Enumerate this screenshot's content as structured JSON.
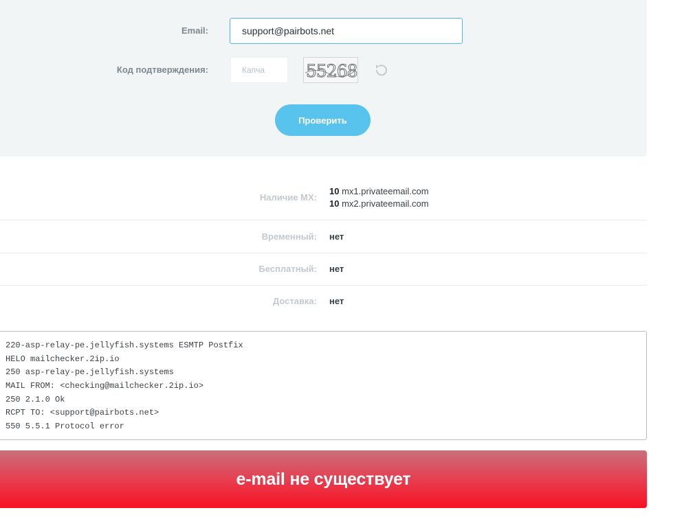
{
  "form": {
    "email_label": "Email:",
    "email_value": "support@pairbots.net",
    "captcha_label": "Код подтверждения:",
    "captcha_placeholder": "Капча",
    "captcha_text": "55268",
    "refresh_icon": "refresh-icon",
    "check_button": "Проверить"
  },
  "results": {
    "mx_label": "Наличие MX:",
    "mx_records": [
      {
        "priority": "10",
        "host": "mx1.privateemail.com"
      },
      {
        "priority": "10",
        "host": "mx2.privateemail.com"
      }
    ],
    "temporary_label": "Временный:",
    "temporary_value": "нет",
    "free_label": "Бесплатный:",
    "free_value": "нет",
    "delivery_label": "Доставка:",
    "delivery_value": "нет"
  },
  "log": [
    "220-asp-relay-pe.jellyfish.systems ESMTP Postfix",
    "HELO mailchecker.2ip.io",
    "250 asp-relay-pe.jellyfish.systems",
    "MAIL FROM: <checking@mailchecker.2ip.io>",
    "250 2.1.0 Ok",
    "RCPT TO: <support@pairbots.net>",
    "550 5.5.1 Protocol error"
  ],
  "verdict": "e-mail не существует",
  "colors": {
    "accent": "#58c3ec",
    "error": "#f71123",
    "panel": "#f2f5f6"
  }
}
